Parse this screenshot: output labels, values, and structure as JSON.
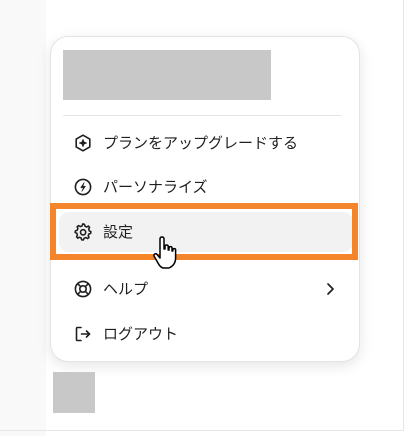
{
  "menu": {
    "items": [
      {
        "label": "プランをアップグレードする",
        "icon": "upgrade-sparkle-icon"
      },
      {
        "label": "パーソナライズ",
        "icon": "personalize-icon"
      },
      {
        "label": "設定",
        "icon": "gear-icon"
      },
      {
        "label": "ヘルプ",
        "icon": "lifebuoy-icon",
        "submenu_icon": "chevron-right-icon"
      },
      {
        "label": "ログアウト",
        "icon": "logout-icon"
      }
    ]
  },
  "highlight_color": "#f5852b",
  "placeholder_color": "#c8c8c8"
}
